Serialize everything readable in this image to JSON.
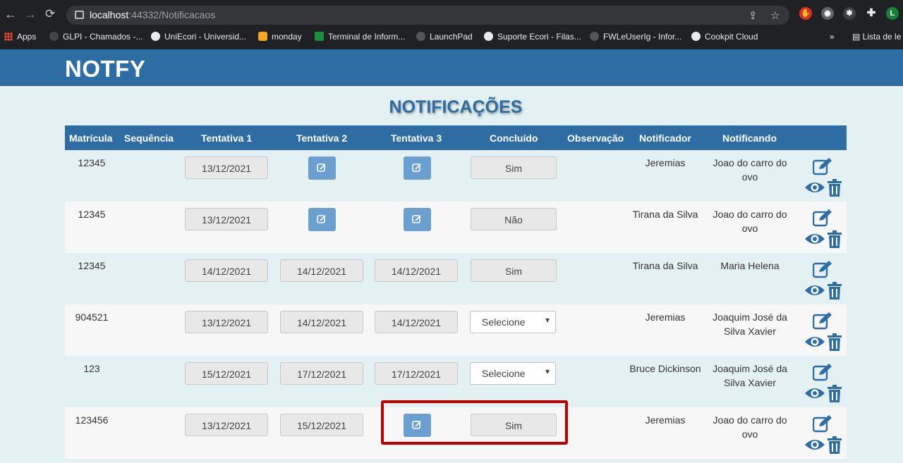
{
  "browser": {
    "url_host": "localhost",
    "url_rest": ":44332/Notificacaos",
    "bookmarks": [
      "Apps",
      "GLPI - Chamados -...",
      "UniEcori - Universid...",
      "monday",
      "Terminal de Inform...",
      "LaunchPad",
      "Suporte Ecori - Filas...",
      "FWLeUserIg - Infor...",
      "Cookpit Cloud"
    ],
    "overflow": "»",
    "reading_list": "Lista de le",
    "profile_initial": "L"
  },
  "app": {
    "brand": "NOTFY",
    "page_title": "NOTIFICAÇÕES"
  },
  "table": {
    "headers": [
      "Matrícula",
      "Sequência",
      "Tentativa 1",
      "Tentativa 2",
      "Tentativa 3",
      "Concluído",
      "Observação",
      "Notificador",
      "Notificando"
    ],
    "rows": [
      {
        "matricula": "12345",
        "sequencia": "",
        "t1": "13/12/2021",
        "t2": "",
        "t3": "",
        "concluido": "Sim",
        "observacao": "",
        "notificador": "Jeremias",
        "notificando": "Joao do carro do ovo"
      },
      {
        "matricula": "12345",
        "sequencia": "",
        "t1": "13/12/2021",
        "t2": "",
        "t3": "",
        "concluido": "Não",
        "observacao": "",
        "notificador": "Tirana da Silva",
        "notificando": "Joao do carro do ovo"
      },
      {
        "matricula": "12345",
        "sequencia": "",
        "t1": "14/12/2021",
        "t2": "14/12/2021",
        "t3": "14/12/2021",
        "concluido": "Sim",
        "observacao": "",
        "notificador": "Tirana da Silva",
        "notificando": "Maria Helena"
      },
      {
        "matricula": "904521",
        "sequencia": "",
        "t1": "13/12/2021",
        "t2": "14/12/2021",
        "t3": "14/12/2021",
        "concluido": "Selecione",
        "observacao": "",
        "notificador": "Jeremias",
        "notificando": "Joaquim José da Silva Xavier"
      },
      {
        "matricula": "123",
        "sequencia": "",
        "t1": "15/12/2021",
        "t2": "17/12/2021",
        "t3": "17/12/2021",
        "concluido": "Selecione",
        "observacao": "",
        "notificador": "Bruce Dickinson",
        "notificando": "Joaquim José da Silva Xavier"
      },
      {
        "matricula": "123456",
        "sequencia": "",
        "t1": "13/12/2021",
        "t2": "15/12/2021",
        "t3": "",
        "concluido": "Sim",
        "observacao": "",
        "notificador": "Jeremias",
        "notificando": "Joao do carro do ovo"
      }
    ]
  },
  "colors": {
    "primary": "#2e6da4",
    "button": "#6a9fd0",
    "highlight": "#c00000",
    "page_bg": "#e4f1f2"
  }
}
